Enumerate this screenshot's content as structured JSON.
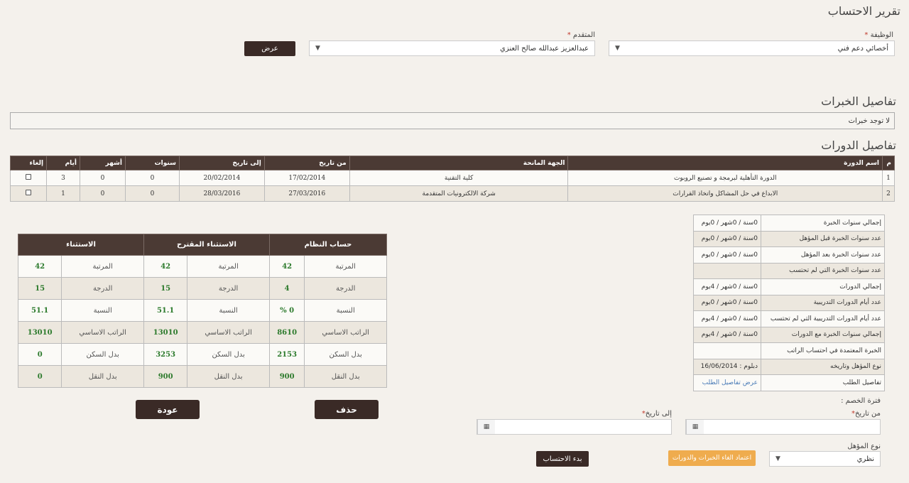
{
  "page": {
    "title": "تقرير الاحتساب"
  },
  "filters": {
    "job_label": "الوظيفة",
    "job_value": "أخصائي دعم فني",
    "applicant_label": "المتقدم",
    "applicant_value": "عبدالعزيز عبدالله صالح العنزي",
    "required_mark": "*",
    "show_button": "عرض"
  },
  "experience": {
    "title": "تفاصيل الخبرات",
    "empty_text": "لا توجد خبرات"
  },
  "courses": {
    "title": "تفاصيل الدورات",
    "headers": [
      "م",
      "اسم الدورة",
      "الجهة المانحة",
      "من تاريخ",
      "إلى تاريخ",
      "سنوات",
      "أشهر",
      "أيام",
      "إلغاء"
    ],
    "rows": [
      {
        "num": "1",
        "name": "الدورة التأهلية لبرمجة و تصنيع الروبوت",
        "provider": "كلية التقنية",
        "from": "17/02/2014",
        "to": "20/02/2014",
        "years": "0",
        "months": "0",
        "days": "3"
      },
      {
        "num": "2",
        "name": "الابداع في حل المشاكل واتخاذ القرارات",
        "provider": "شركة الالكترونيات المتقدمة",
        "from": "27/03/2016",
        "to": "28/03/2016",
        "years": "0",
        "months": "0",
        "days": "1"
      }
    ]
  },
  "summary": {
    "rows": [
      {
        "label": "إجمالي سنوات الخبرة",
        "value": "0سنة / 0شهر / 0يوم"
      },
      {
        "label": "عدد سنوات الخبرة قبل المؤهل",
        "value": "0سنة / 0شهر / 0يوم"
      },
      {
        "label": "عدد سنوات الخبرة بعد المؤهل",
        "value": "0سنة / 0شهر / 0يوم"
      },
      {
        "label": "عدد سنوات الخبرة التي لم تحتسب",
        "value": ""
      },
      {
        "label": "إجمالي الدورات",
        "value": "0سنة / 0شهر / 4يوم"
      },
      {
        "label": "عدد أيام الدورات التدريبية",
        "value": "0سنة / 0شهر / 0يوم"
      },
      {
        "label": "عدد أيام الدورات التدريبية التي لم تحتسب",
        "value": "0سنة / 0شهر / 4يوم"
      },
      {
        "label": "إجمالي سنوات الخبرة مع الدورات",
        "value": "0سنة / 0شهر / 4يوم"
      },
      {
        "label": "الخبرة المعتمدة في احتساب الراتب",
        "value": ""
      },
      {
        "label": "نوع المؤهل وتاريخه",
        "value": "دبلوم : 16/06/2014"
      },
      {
        "label": "تفاصيل الطلب",
        "value": "عرض تفاصيل الطلب"
      }
    ]
  },
  "calc": {
    "headers": [
      "حساب النظام",
      "الاستثناء المقترح",
      "الاستثناء"
    ],
    "rows": [
      {
        "sys_label": "المرتبة",
        "sys_val": "42",
        "prop_label": "المرتبة",
        "prop_val": "42",
        "exc_label": "المرتبة",
        "exc_val": "42"
      },
      {
        "sys_label": "الدرجة",
        "sys_val": "4",
        "prop_label": "الدرجة",
        "prop_val": "15",
        "exc_label": "الدرجة",
        "exc_val": "15"
      },
      {
        "sys_label": "النسبة",
        "sys_val": "0 %",
        "prop_label": "النسبة",
        "prop_val": "51.1",
        "exc_label": "النسبة",
        "exc_val": "51.1"
      },
      {
        "sys_label": "الراتب الاساسي",
        "sys_val": "8610",
        "prop_label": "الراتب الاساسي",
        "prop_val": "13010",
        "exc_label": "الراتب الاساسي",
        "exc_val": "13010"
      },
      {
        "sys_label": "بدل السكن",
        "sys_val": "2153",
        "prop_label": "بدل السكن",
        "prop_val": "3253",
        "exc_label": "بدل السكن",
        "exc_val": "0"
      },
      {
        "sys_label": "بدل النقل",
        "sys_val": "900",
        "prop_label": "بدل النقل",
        "prop_val": "900",
        "exc_label": "بدل النقل",
        "exc_val": "0"
      }
    ],
    "delete_button": "حذف",
    "back_button": "عودة"
  },
  "deduction": {
    "period_label": "فترة الخصم :",
    "from_label": "من تاريخ",
    "to_label": "إلى تاريخ",
    "required_mark": "*",
    "qual_type_label": "نوع المؤهل",
    "qual_type_value": "نظري",
    "approve_button": "اعتماد الغاء الخبرات والدورات",
    "start_button": "بدء الاحتساب"
  },
  "colors": {
    "header_bg": "#4b3a34",
    "accent_orange": "#efac4e",
    "value_green": "#2c7a2c"
  }
}
